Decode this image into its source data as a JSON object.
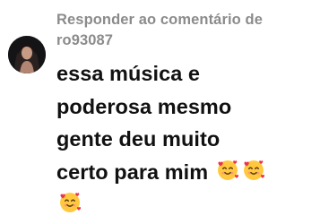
{
  "reply_header": {
    "label": "Responder ao comentário de",
    "username": "ro93087"
  },
  "comment": {
    "lines": [
      "essa música e",
      "poderosa mesmo",
      "gente deu muito",
      "certo para mim"
    ],
    "emojis": [
      "smiling-face-with-hearts-icon",
      "smiling-face-with-hearts-icon",
      "smiling-face-with-hearts-icon"
    ]
  },
  "colors": {
    "header_text": "#8b8b8b",
    "comment_text": "#111111",
    "background": "#ffffff",
    "emoji_face": "#ffc83d",
    "emoji_heart": "#e8344e"
  }
}
